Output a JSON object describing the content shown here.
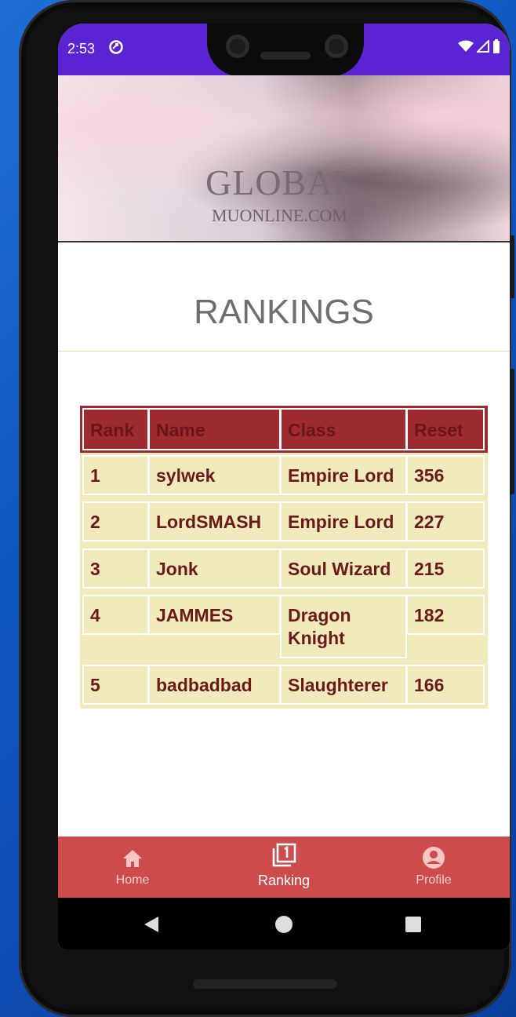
{
  "status_bar": {
    "time": "2:53",
    "accent_color": "#5a24d4"
  },
  "banner": {
    "logo_line1": "GLOBAL",
    "logo_line2": "MUONLINE.COM"
  },
  "page": {
    "title": "RANKINGS"
  },
  "rankings": {
    "columns": [
      "Rank",
      "Name",
      "Class",
      "Reset"
    ],
    "rows": [
      [
        "1",
        "sylwek",
        "Empire Lord",
        "356"
      ],
      [
        "2",
        "LordSMASH",
        "Empire Lord",
        "227"
      ],
      [
        "3",
        "Jonk",
        "Soul Wizard",
        "215"
      ],
      [
        "4",
        "JAMMES",
        "Dragon Knight",
        "182"
      ],
      [
        "5",
        "badbadbad",
        "Slaughterer",
        "166"
      ]
    ],
    "header_color": "#9e2b2f",
    "body_color": "#f1ebbb"
  },
  "bottom_nav": {
    "items": [
      {
        "label": "Home",
        "icon": "home-icon",
        "active": false
      },
      {
        "label": "Ranking",
        "icon": "ranking-icon",
        "active": true
      },
      {
        "label": "Profile",
        "icon": "profile-icon",
        "active": false
      }
    ],
    "color": "#cd4b4b"
  },
  "system_nav": {
    "icons": [
      "back-icon",
      "home-circle-icon",
      "recents-icon"
    ]
  }
}
